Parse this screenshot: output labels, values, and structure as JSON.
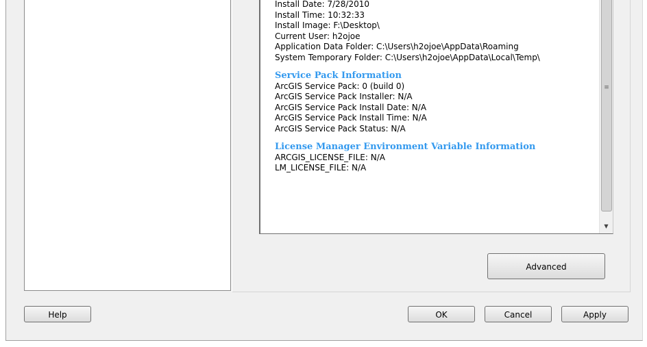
{
  "install_info": {
    "lines": [
      "Install Date: 7/28/2010",
      "Install Time: 10:32:33",
      "Install Image: F:\\Desktop\\",
      "Current User: h2ojoe",
      "Application Data Folder: C:\\Users\\h2ojoe\\AppData\\Roaming",
      "System Temporary Folder: C:\\Users\\h2ojoe\\AppData\\Local\\Temp\\"
    ]
  },
  "service_pack": {
    "heading": "Service Pack Information",
    "lines": [
      "ArcGIS Service Pack: 0 (build 0)",
      "ArcGIS Service Pack Installer: N/A",
      "ArcGIS Service Pack Install Date: N/A",
      "ArcGIS Service Pack Install Time: N/A",
      "ArcGIS Service Pack Status: N/A"
    ]
  },
  "license_manager": {
    "heading": "License Manager Environment Variable Information",
    "lines": [
      "ARCGIS_LICENSE_FILE: N/A",
      "LM_LICENSE_FILE: N/A"
    ]
  },
  "buttons": {
    "advanced": "Advanced",
    "help": "Help",
    "ok": "OK",
    "cancel": "Cancel",
    "apply": "Apply"
  },
  "icons": {
    "scroll_grip": "≡",
    "scroll_down": "▼"
  }
}
